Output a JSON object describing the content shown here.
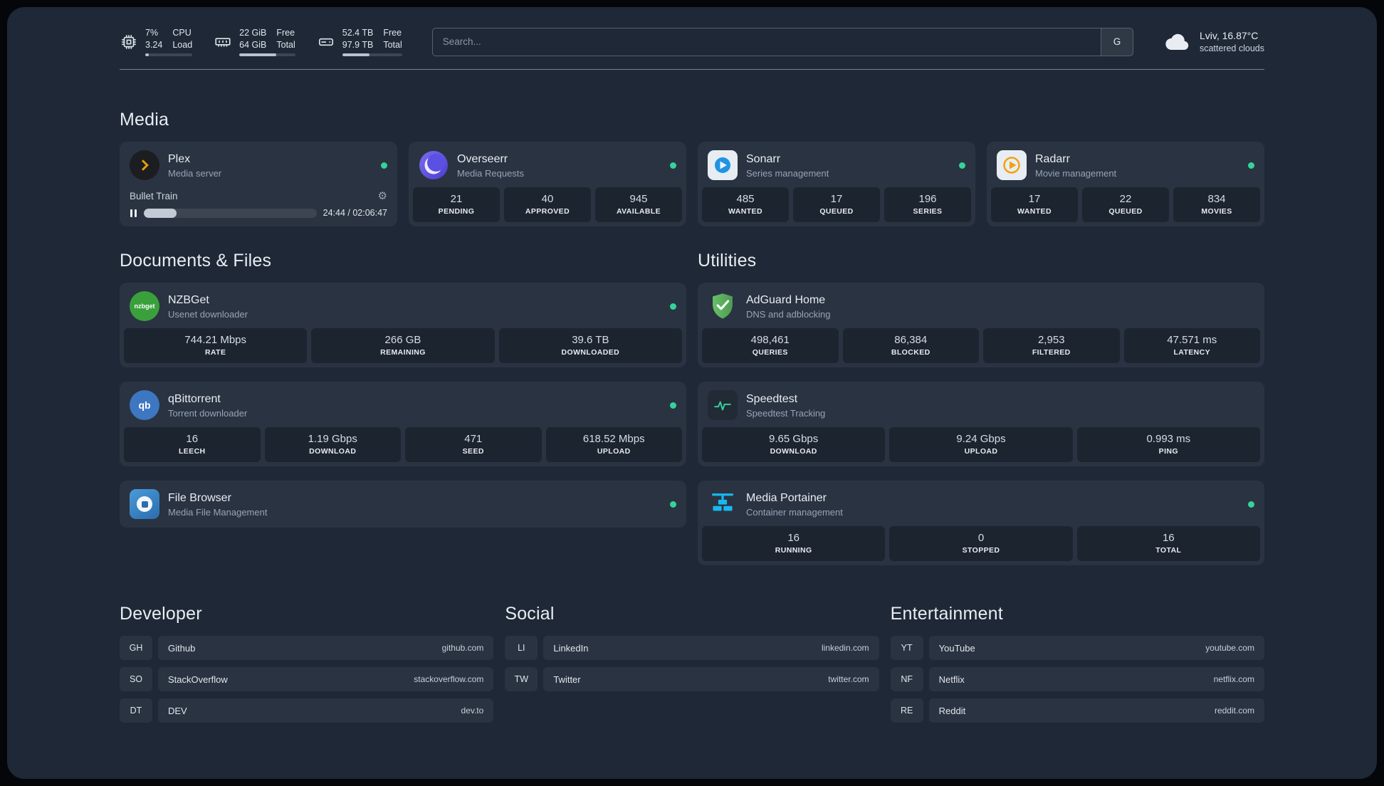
{
  "colors": {
    "status_ok": "#34d399",
    "accent_plex": "#e5a00d",
    "accent_portainer": "#17b8f0",
    "accent_adguard": "#63b764"
  },
  "topbar": {
    "cpu": {
      "line1a": "7%",
      "line2a": "3.24",
      "line1b": "CPU",
      "line2b": "Load",
      "progress_pct": 7
    },
    "memory": {
      "line1a": "22 GiB",
      "line2a": "64 GiB",
      "line1b": "Free",
      "line2b": "Total",
      "progress_pct": 66
    },
    "disk": {
      "line1a": "52.4 TB",
      "line2a": "97.9 TB",
      "line1b": "Free",
      "line2b": "Total",
      "progress_pct": 46
    },
    "search": {
      "placeholder": "Search...",
      "provider_label": "G"
    },
    "weather": {
      "location": "Lviv, 16.87°C",
      "condition": "scattered clouds"
    }
  },
  "sections": {
    "media": {
      "title": "Media"
    },
    "documents": {
      "title": "Documents & Files"
    },
    "utilities": {
      "title": "Utilities"
    },
    "developer": {
      "title": "Developer"
    },
    "social": {
      "title": "Social"
    },
    "entertainment": {
      "title": "Entertainment"
    }
  },
  "services": {
    "plex": {
      "name": "Plex",
      "subtitle": "Media server",
      "now_playing": "Bullet Train",
      "time": "24:44 / 02:06:47",
      "progress_pct": 19
    },
    "overseerr": {
      "name": "Overseerr",
      "subtitle": "Media Requests",
      "stats": [
        {
          "value": "21",
          "label": "PENDING"
        },
        {
          "value": "40",
          "label": "APPROVED"
        },
        {
          "value": "945",
          "label": "AVAILABLE"
        }
      ]
    },
    "sonarr": {
      "name": "Sonarr",
      "subtitle": "Series management",
      "stats": [
        {
          "value": "485",
          "label": "WANTED"
        },
        {
          "value": "17",
          "label": "QUEUED"
        },
        {
          "value": "196",
          "label": "SERIES"
        }
      ]
    },
    "radarr": {
      "name": "Radarr",
      "subtitle": "Movie management",
      "stats": [
        {
          "value": "17",
          "label": "WANTED"
        },
        {
          "value": "22",
          "label": "QUEUED"
        },
        {
          "value": "834",
          "label": "MOVIES"
        }
      ]
    },
    "nzbget": {
      "name": "NZBGet",
      "subtitle": "Usenet downloader",
      "icon_text": "nzbget",
      "stats": [
        {
          "value": "744.21 Mbps",
          "label": "RATE"
        },
        {
          "value": "266 GB",
          "label": "REMAINING"
        },
        {
          "value": "39.6 TB",
          "label": "DOWNLOADED"
        }
      ]
    },
    "qbittorrent": {
      "name": "qBittorrent",
      "subtitle": "Torrent downloader",
      "icon_text": "qb",
      "stats": [
        {
          "value": "16",
          "label": "LEECH"
        },
        {
          "value": "1.19 Gbps",
          "label": "DOWNLOAD"
        },
        {
          "value": "471",
          "label": "SEED"
        },
        {
          "value": "618.52 Mbps",
          "label": "UPLOAD"
        }
      ]
    },
    "filebrowser": {
      "name": "File Browser",
      "subtitle": "Media File Management"
    },
    "adguard": {
      "name": "AdGuard Home",
      "subtitle": "DNS and adblocking",
      "stats": [
        {
          "value": "498,461",
          "label": "QUERIES"
        },
        {
          "value": "86,384",
          "label": "BLOCKED"
        },
        {
          "value": "2,953",
          "label": "FILTERED"
        },
        {
          "value": "47.571 ms",
          "label": "LATENCY"
        }
      ]
    },
    "speedtest": {
      "name": "Speedtest",
      "subtitle": "Speedtest Tracking",
      "stats": [
        {
          "value": "9.65 Gbps",
          "label": "DOWNLOAD"
        },
        {
          "value": "9.24 Gbps",
          "label": "UPLOAD"
        },
        {
          "value": "0.993 ms",
          "label": "PING"
        }
      ]
    },
    "portainer": {
      "name": "Media Portainer",
      "subtitle": "Container management",
      "stats": [
        {
          "value": "16",
          "label": "RUNNING"
        },
        {
          "value": "0",
          "label": "STOPPED"
        },
        {
          "value": "16",
          "label": "TOTAL"
        }
      ]
    }
  },
  "bookmarks": {
    "developer": [
      {
        "abbr": "GH",
        "name": "Github",
        "domain": "github.com"
      },
      {
        "abbr": "SO",
        "name": "StackOverflow",
        "domain": "stackoverflow.com"
      },
      {
        "abbr": "DT",
        "name": "DEV",
        "domain": "dev.to"
      }
    ],
    "social": [
      {
        "abbr": "LI",
        "name": "LinkedIn",
        "domain": "linkedin.com"
      },
      {
        "abbr": "TW",
        "name": "Twitter",
        "domain": "twitter.com"
      }
    ],
    "entertainment": [
      {
        "abbr": "YT",
        "name": "YouTube",
        "domain": "youtube.com"
      },
      {
        "abbr": "NF",
        "name": "Netflix",
        "domain": "netflix.com"
      },
      {
        "abbr": "RE",
        "name": "Reddit",
        "domain": "reddit.com"
      }
    ]
  }
}
